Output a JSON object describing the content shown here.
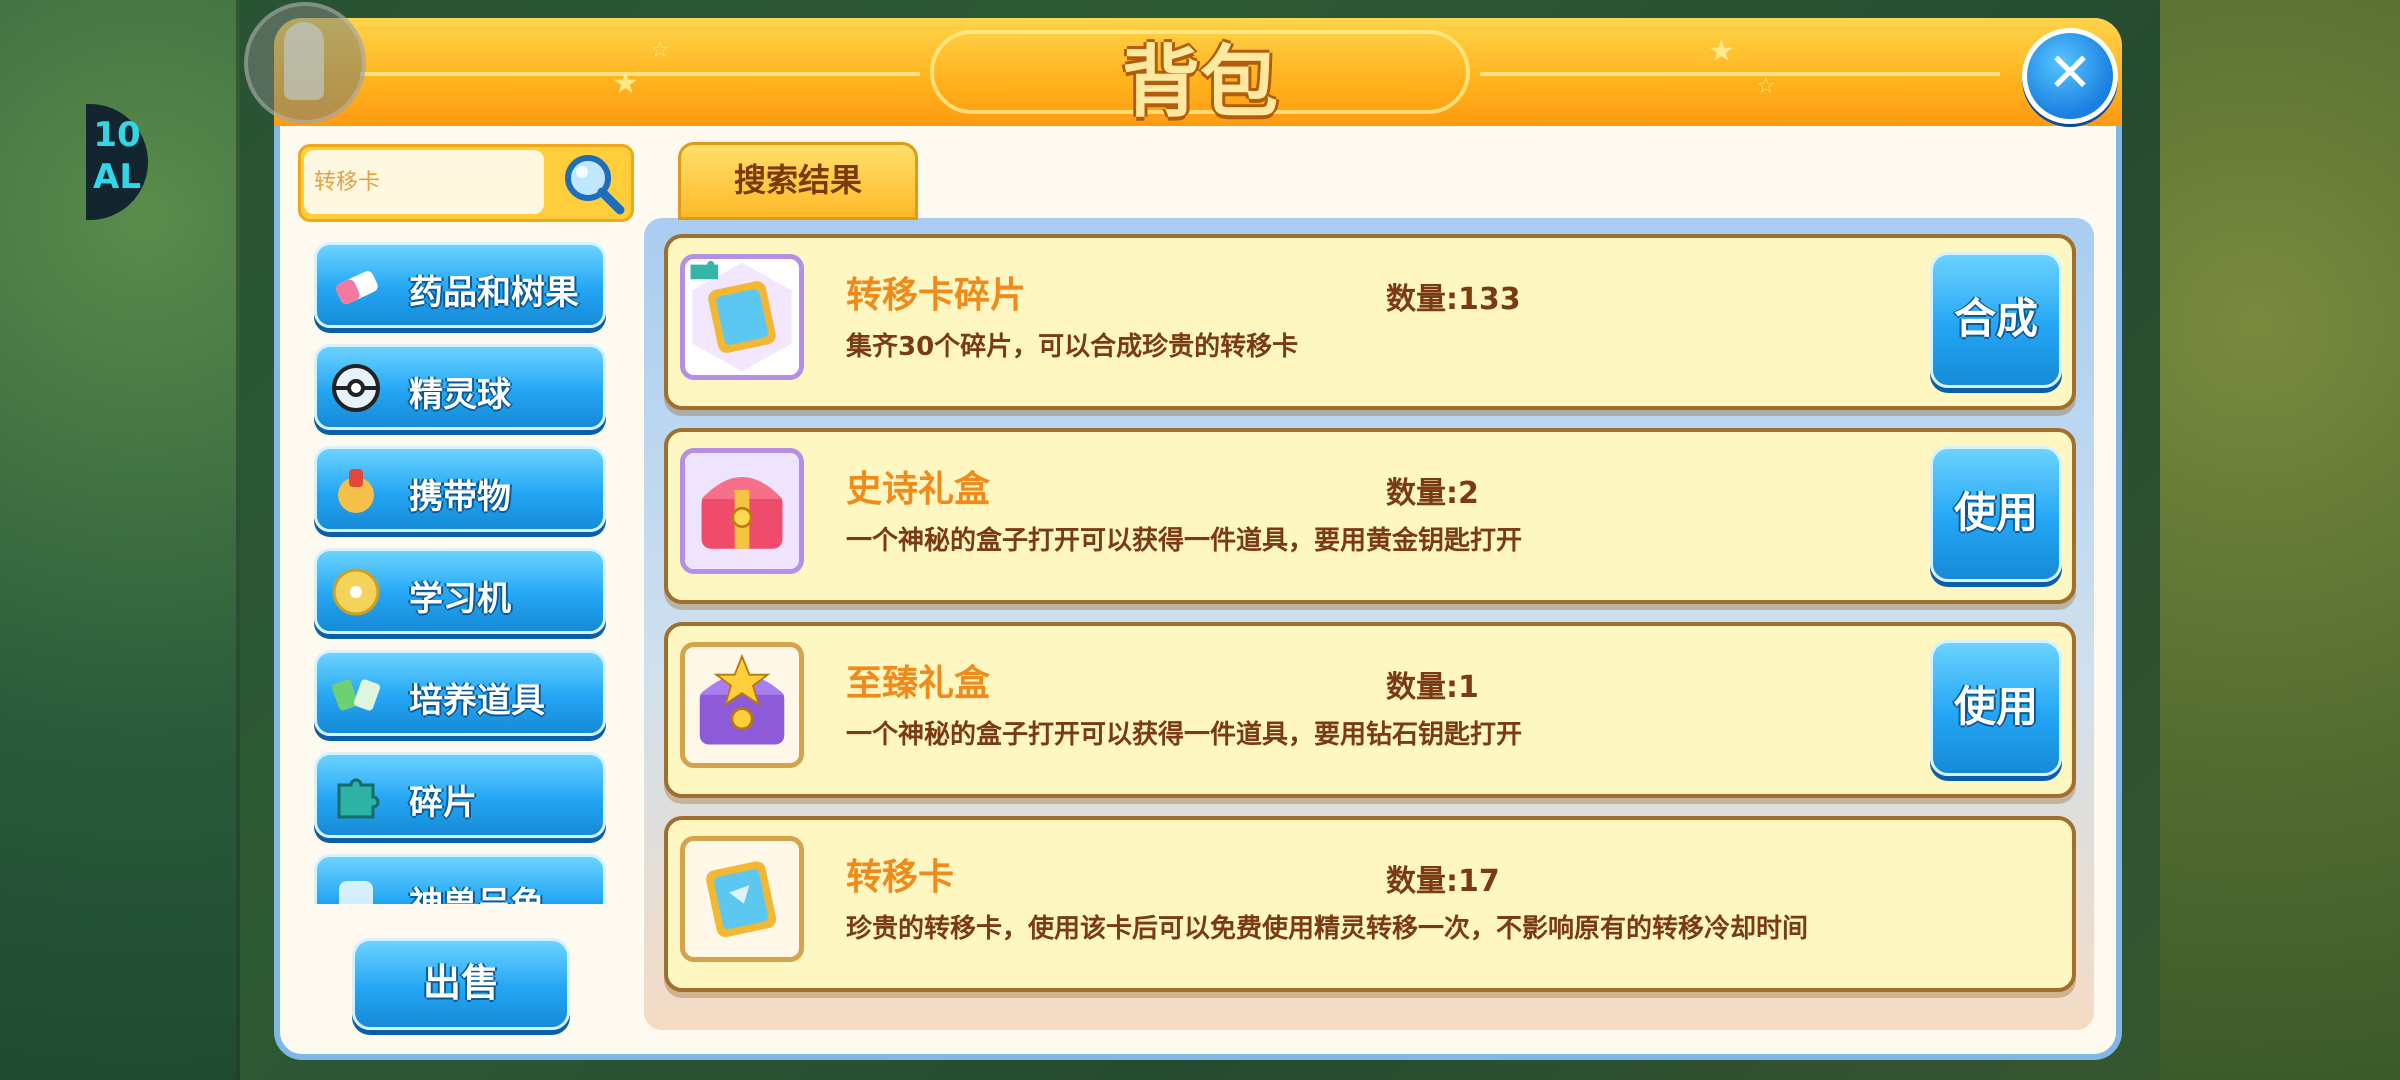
{
  "dialog": {
    "title": "背包"
  },
  "search": {
    "value": "",
    "placeholder": "转移卡"
  },
  "categories": [
    {
      "label": "药品和树果",
      "icon": "potion-icon"
    },
    {
      "label": "精灵球",
      "icon": "pokeball-icon"
    },
    {
      "label": "携带物",
      "icon": "held-item-icon"
    },
    {
      "label": "学习机",
      "icon": "disc-icon"
    },
    {
      "label": "培养道具",
      "icon": "training-item-icon"
    },
    {
      "label": "碎片",
      "icon": "puzzle-piece-icon"
    },
    {
      "label": "神兽呈龟",
      "icon": "legendary-item-icon"
    }
  ],
  "sell_button": "出售",
  "results_tab": "搜索结果",
  "items": [
    {
      "name": "转移卡碎片",
      "quantity": "数量:133",
      "description": "集齐30个碎片，可以合成珍贵的转移卡",
      "action": "合成",
      "icon": "transfer-card-fragment-icon"
    },
    {
      "name": "史诗礼盒",
      "quantity": "数量:2",
      "description": "一个神秘的盒子打开可以获得一件道具，要用黄金钥匙打开",
      "action": "使用",
      "icon": "epic-gift-box-icon"
    },
    {
      "name": "至臻礼盒",
      "quantity": "数量:1",
      "description": "一个神秘的盒子打开可以获得一件道具，要用钻石钥匙打开",
      "action": "使用",
      "icon": "supreme-gift-box-icon"
    },
    {
      "name": "转移卡",
      "quantity": "数量:17",
      "description": "珍贵的转移卡，使用该卡后可以免费使用精灵转移一次，不影响原有的转移冷却时间",
      "action": "",
      "icon": "transfer-card-icon"
    }
  ],
  "colors": {
    "accent_orange": "#ffb21c",
    "button_blue": "#24a6f4",
    "item_name": "#f08a1a",
    "item_text": "#7a3b12"
  }
}
